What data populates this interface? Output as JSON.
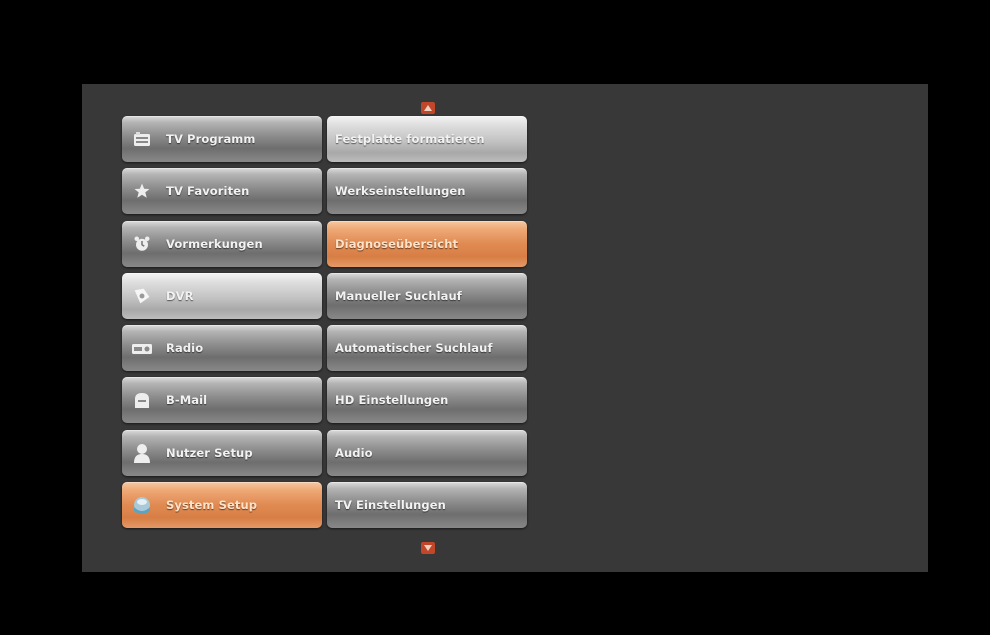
{
  "main_menu": {
    "items": [
      {
        "label": "TV Programm",
        "icon": "tv-guide-icon"
      },
      {
        "label": "TV Favoriten",
        "icon": "star-icon"
      },
      {
        "label": "Vormerkungen",
        "icon": "alarm-clock-icon"
      },
      {
        "label": "DVR",
        "icon": "record-disc-icon"
      },
      {
        "label": "Radio",
        "icon": "radio-icon"
      },
      {
        "label": "B-Mail",
        "icon": "mailbox-icon"
      },
      {
        "label": "Nutzer Setup",
        "icon": "user-icon"
      },
      {
        "label": "System Setup",
        "icon": "system-setup-icon"
      }
    ],
    "selected_index": 7
  },
  "sub_menu": {
    "items": [
      {
        "label": "Festplatte formatieren"
      },
      {
        "label": "Werkseinstellungen"
      },
      {
        "label": "Diagnoseübersicht"
      },
      {
        "label": "Manueller Suchlauf"
      },
      {
        "label": "Automatischer Suchlauf"
      },
      {
        "label": "HD Einstellungen"
      },
      {
        "label": "Audio"
      },
      {
        "label": "TV Einstellungen"
      }
    ],
    "selected_index": 2
  },
  "scroll": {
    "up_icon": "scroll-up-arrow-icon",
    "down_icon": "scroll-down-arrow-icon"
  },
  "colors": {
    "accent": "#e08a52",
    "panel": "#383838",
    "background": "#000000"
  }
}
